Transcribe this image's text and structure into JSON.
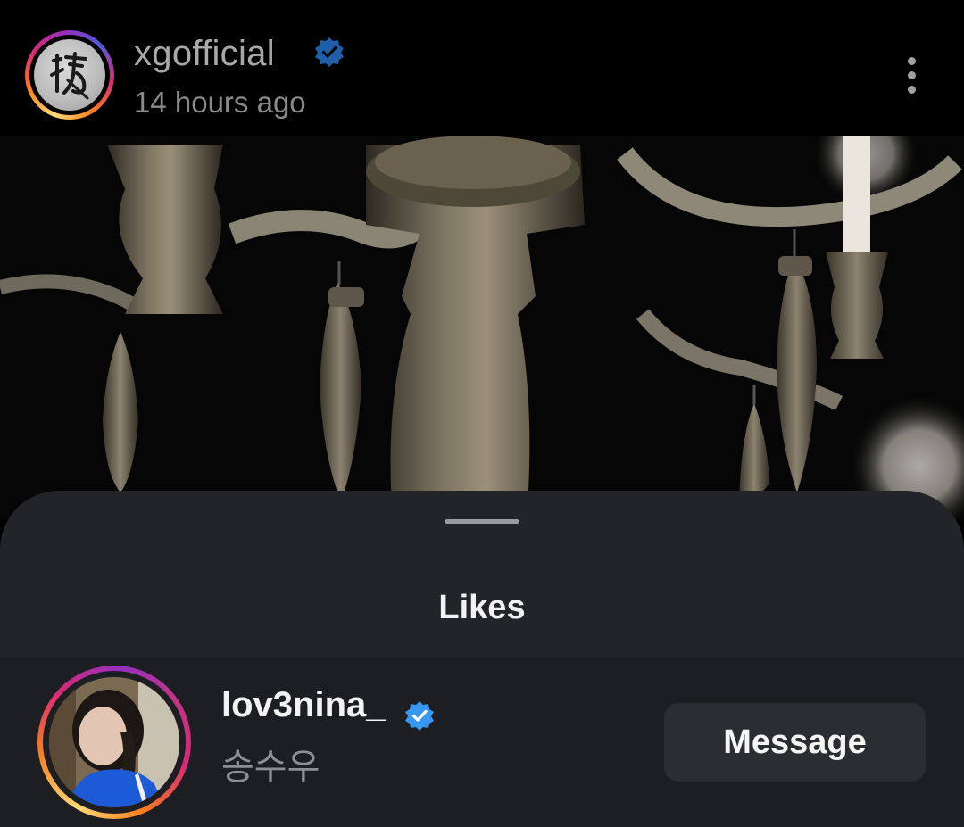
{
  "post": {
    "username": "xgofficial",
    "timestamp": "14 hours ago",
    "verified": true,
    "avatar_icon": "calligraphy-logo-icon",
    "more_icon": "more-vertical-icon",
    "image_description_icon": "chandelier-photo"
  },
  "likes_sheet": {
    "title": "Likes",
    "items": [
      {
        "username": "lov3nina_",
        "full_name": "송수우",
        "verified": true,
        "action_label": "Message"
      }
    ]
  },
  "colors": {
    "verified_badge": "#3897f0",
    "sheet_background": "#232428",
    "row_background": "#1d1e22",
    "button_background": "#2c2d32"
  }
}
